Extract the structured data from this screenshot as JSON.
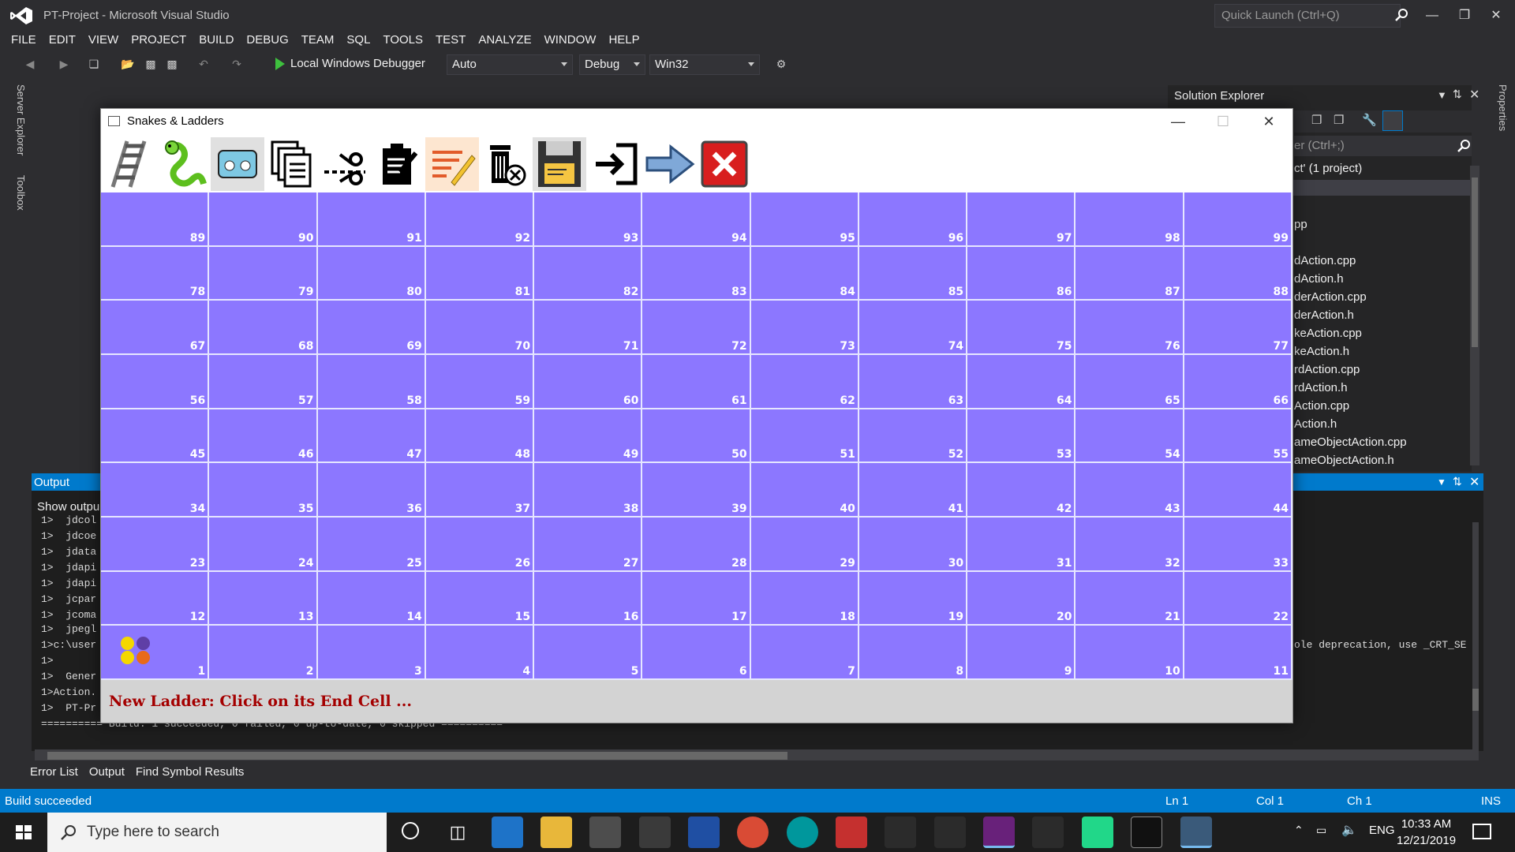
{
  "vs": {
    "title": "PT-Project - Microsoft Visual Studio",
    "quick_launch_placeholder": "Quick Launch (Ctrl+Q)",
    "menu": [
      "FILE",
      "EDIT",
      "VIEW",
      "PROJECT",
      "BUILD",
      "DEBUG",
      "TEAM",
      "SQL",
      "TOOLS",
      "TEST",
      "ANALYZE",
      "WINDOW",
      "HELP"
    ],
    "toolbar": {
      "debugger_label": "Local Windows Debugger",
      "combo_auto": "Auto",
      "combo_config": "Debug",
      "combo_platform": "Win32"
    },
    "side_tabs": {
      "server_explorer": "Server Explorer",
      "toolbox": "Toolbox",
      "properties": "Properties"
    },
    "solution_explorer": {
      "title": "Solution Explorer",
      "search_placeholder": "er (Ctrl+;)",
      "root_label": "ct' (1 project)",
      "files": [
        "pp",
        "dAction.cpp",
        "dAction.h",
        "derAction.cpp",
        "derAction.h",
        "keAction.cpp",
        "keAction.h",
        "rdAction.cpp",
        "rdAction.h",
        "Action.cpp",
        "Action.h",
        "ameObjectAction.cpp",
        "ameObjectAction.h"
      ]
    },
    "output": {
      "title": "Output",
      "show_from_label": "Show outpu",
      "lines": [
        "1>  jdcol",
        "1>  jdcoe",
        "1>  jdata",
        "1>  jdapi",
        "1>  jdapi",
        "1>  jcpar",
        "1>  jcoma",
        "1>  jpegl",
        "1>c:\\user",
        "1>",
        "1>  Gener",
        "1>Action.",
        "1>  PT-Pr",
        "========== Build: 1 succeeded, 0 failed, 0 up-to-date, 0 skipped =========="
      ],
      "right_text": "ole deprecation, use _CRT_SE"
    },
    "bottom_tabs": [
      "Error List",
      "Output",
      "Find Symbol Results"
    ],
    "status": {
      "message": "Build succeeded",
      "line": "Ln 1",
      "col": "Col 1",
      "ch": "Ch 1",
      "mode": "INS"
    }
  },
  "taskbar": {
    "search_placeholder": "Type here to search",
    "language": "ENG",
    "time": "10:33 AM",
    "date": "12/21/2019"
  },
  "game": {
    "window_title": "Snakes & Ladders",
    "tools": [
      "ladder-icon",
      "snake-icon",
      "card-icon",
      "copy-icon",
      "cut-icon",
      "paste-icon",
      "edit-icon",
      "delete-icon",
      "save-icon",
      "open-icon",
      "switch-to-play-icon",
      "exit-icon"
    ],
    "board_rows": [
      [
        "89",
        "90",
        "91",
        "92",
        "93",
        "94",
        "95",
        "96",
        "97",
        "98",
        "99"
      ],
      [
        "78",
        "79",
        "80",
        "81",
        "82",
        "83",
        "84",
        "85",
        "86",
        "87",
        "88"
      ],
      [
        "67",
        "68",
        "69",
        "70",
        "71",
        "72",
        "73",
        "74",
        "75",
        "76",
        "77"
      ],
      [
        "56",
        "57",
        "58",
        "59",
        "60",
        "61",
        "62",
        "63",
        "64",
        "65",
        "66"
      ],
      [
        "45",
        "46",
        "47",
        "48",
        "49",
        "50",
        "51",
        "52",
        "53",
        "54",
        "55"
      ],
      [
        "34",
        "35",
        "36",
        "37",
        "38",
        "39",
        "40",
        "41",
        "42",
        "43",
        "44"
      ],
      [
        "23",
        "24",
        "25",
        "26",
        "27",
        "28",
        "29",
        "30",
        "31",
        "32",
        "33"
      ],
      [
        "12",
        "13",
        "14",
        "15",
        "16",
        "17",
        "18",
        "19",
        "20",
        "21",
        "22"
      ],
      [
        "1",
        "2",
        "3",
        "4",
        "5",
        "6",
        "7",
        "8",
        "9",
        "10",
        "11"
      ]
    ],
    "cell_color": "#8c77ff",
    "player_colors": [
      "#f5d800",
      "#5f3fa6",
      "#f5d800",
      "#e86a1a"
    ],
    "status_message": "New Ladder: Click on its End Cell ..."
  }
}
